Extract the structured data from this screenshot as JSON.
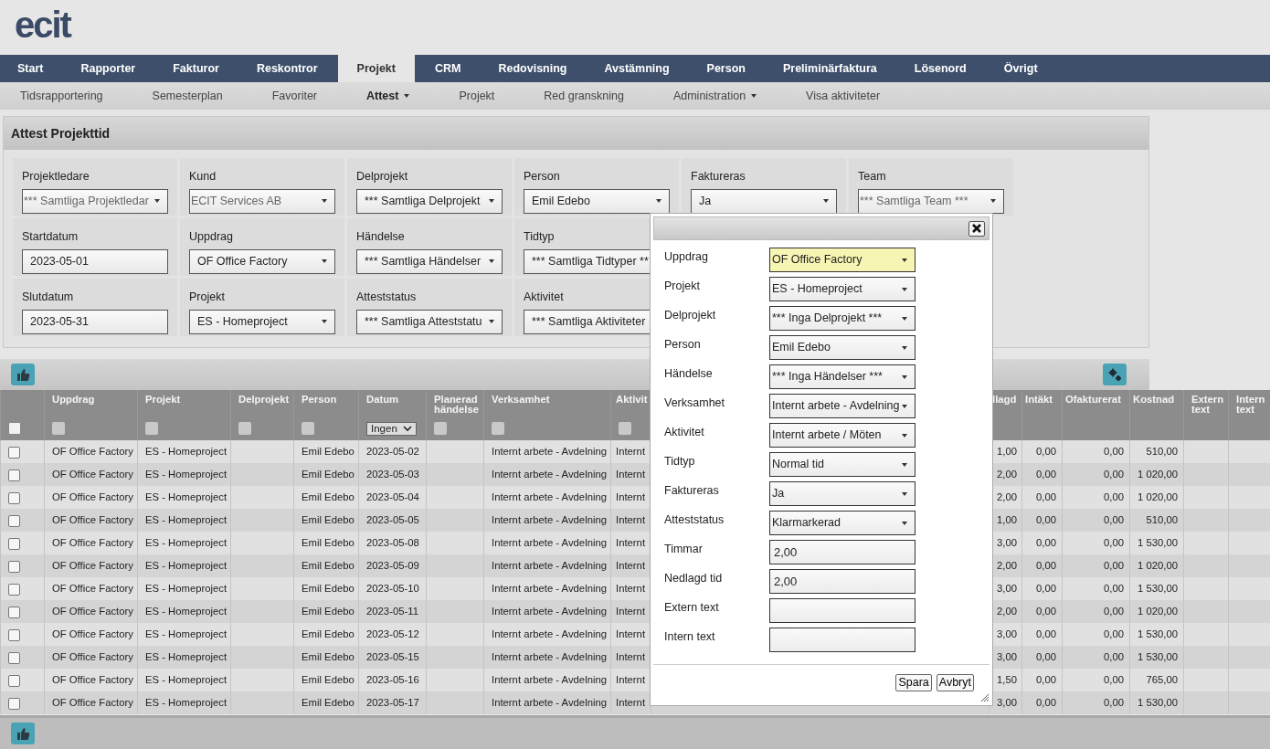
{
  "logo": "ecit",
  "main_nav": [
    {
      "label": "Start",
      "selected": false
    },
    {
      "label": "Rapporter",
      "selected": false
    },
    {
      "label": "Fakturor",
      "selected": false
    },
    {
      "label": "Reskontror",
      "selected": false
    },
    {
      "label": "Projekt",
      "selected": true
    },
    {
      "label": "CRM",
      "selected": false
    },
    {
      "label": "Redovisning",
      "selected": false
    },
    {
      "label": "Avstämning",
      "selected": false
    },
    {
      "label": "Person",
      "selected": false
    },
    {
      "label": "Preliminärfaktura",
      "selected": false
    },
    {
      "label": "Lösenord",
      "selected": false
    },
    {
      "label": "Övrigt",
      "selected": false
    }
  ],
  "sub_nav": [
    {
      "label": "Tidsrapportering",
      "selected": false,
      "dropdown": false
    },
    {
      "label": "Semesterplan",
      "selected": false,
      "dropdown": false
    },
    {
      "label": "Favoriter",
      "selected": false,
      "dropdown": false
    },
    {
      "label": "Attest",
      "selected": true,
      "dropdown": true
    },
    {
      "label": "Projekt",
      "selected": false,
      "dropdown": false
    },
    {
      "label": "Red granskning",
      "selected": false,
      "dropdown": false
    },
    {
      "label": "Administration",
      "selected": false,
      "dropdown": true
    },
    {
      "label": "Visa aktiviteter",
      "selected": false,
      "dropdown": false
    }
  ],
  "panel": {
    "title": "Attest Projekttid",
    "filter_rows": [
      [
        {
          "label": "Projektledare",
          "kind": "select",
          "value": "*** Samtliga Projektledar",
          "disabled": true
        },
        {
          "label": "Kund",
          "kind": "select",
          "value": "ECIT Services AB",
          "disabled": true
        },
        {
          "label": "Delprojekt",
          "kind": "select",
          "value": "*** Samtliga Delprojekt",
          "disabled": false
        },
        {
          "label": "Person",
          "kind": "select",
          "value": "Emil Edebo",
          "disabled": false
        },
        {
          "label": "Faktureras",
          "kind": "select",
          "value": "Ja",
          "disabled": false
        },
        {
          "label": "Team",
          "kind": "select",
          "value": "*** Samtliga Team ***",
          "disabled": true
        }
      ],
      [
        {
          "label": "Startdatum",
          "kind": "date",
          "value": "2023-05-01",
          "disabled": false
        },
        {
          "label": "Uppdrag",
          "kind": "select",
          "value": "OF Office Factory",
          "disabled": false
        },
        {
          "label": "Händelse",
          "kind": "select",
          "value": "*** Samtliga Händelser",
          "disabled": false
        },
        {
          "label": "Tidtyp",
          "kind": "select",
          "value": "*** Samtliga Tidtyper **",
          "disabled": false
        }
      ],
      [
        {
          "label": "Slutdatum",
          "kind": "date",
          "value": "2023-05-31",
          "disabled": false
        },
        {
          "label": "Projekt",
          "kind": "select",
          "value": "ES - Homeproject",
          "disabled": false
        },
        {
          "label": "Atteststatus",
          "kind": "select",
          "value": "*** Samtliga Atteststatu",
          "disabled": false
        },
        {
          "label": "Aktivitet",
          "kind": "select",
          "value": "*** Samtliga Aktiviteter",
          "disabled": false
        }
      ]
    ]
  },
  "table": {
    "select_all": {
      "checked": false
    },
    "columns": [
      {
        "label": "Uppdrag",
        "kind": "text",
        "filter_checked": false
      },
      {
        "label": "Projekt",
        "kind": "text",
        "filter_checked": false
      },
      {
        "label": "Delprojekt",
        "kind": "text",
        "filter_checked": false
      },
      {
        "label": "Person",
        "kind": "text",
        "filter_checked": false
      },
      {
        "label": "Datum",
        "kind": "text",
        "filter_value": "Ingen"
      },
      {
        "label": "Planerad händelse",
        "kind": "text",
        "filter_checked": false
      },
      {
        "label": "Verksamhet",
        "kind": "text",
        "filter_checked": false
      },
      {
        "label": "Aktivit",
        "kind": "text",
        "filter_checked": false
      },
      {
        "label": "llagd",
        "kind": "number"
      },
      {
        "label": "Intäkt",
        "kind": "number"
      },
      {
        "label": "Ofakturerat",
        "kind": "number"
      },
      {
        "label": "Kostnad",
        "kind": "number"
      },
      {
        "label": "Extern text",
        "kind": "text"
      },
      {
        "label": "Intern text",
        "kind": "text"
      }
    ],
    "rows": [
      {
        "checked": false,
        "cells": [
          "OF Office Factory",
          "ES - Homeproject",
          null,
          "Emil Edebo",
          "2023-05-02",
          null,
          "Internt arbete - Avdelning",
          "Internt",
          "1,00",
          "0,00",
          "0,00",
          "510,00",
          null,
          null
        ]
      },
      {
        "checked": false,
        "cells": [
          "OF Office Factory",
          "ES - Homeproject",
          null,
          "Emil Edebo",
          "2023-05-03",
          null,
          "Internt arbete - Avdelning",
          "Internt",
          "2,00",
          "0,00",
          "0,00",
          "1 020,00",
          null,
          null
        ]
      },
      {
        "checked": false,
        "cells": [
          "OF Office Factory",
          "ES - Homeproject",
          null,
          "Emil Edebo",
          "2023-05-04",
          null,
          "Internt arbete - Avdelning",
          "Internt",
          "2,00",
          "0,00",
          "0,00",
          "1 020,00",
          null,
          null
        ]
      },
      {
        "checked": false,
        "cells": [
          "OF Office Factory",
          "ES - Homeproject",
          null,
          "Emil Edebo",
          "2023-05-05",
          null,
          "Internt arbete - Avdelning",
          "Internt",
          "1,00",
          "0,00",
          "0,00",
          "510,00",
          null,
          null
        ]
      },
      {
        "checked": false,
        "cells": [
          "OF Office Factory",
          "ES - Homeproject",
          null,
          "Emil Edebo",
          "2023-05-08",
          null,
          "Internt arbete - Avdelning",
          "Internt",
          "3,00",
          "0,00",
          "0,00",
          "1 530,00",
          null,
          null
        ]
      },
      {
        "checked": false,
        "cells": [
          "OF Office Factory",
          "ES - Homeproject",
          null,
          "Emil Edebo",
          "2023-05-09",
          null,
          "Internt arbete - Avdelning",
          "Internt",
          "2,00",
          "0,00",
          "0,00",
          "1 020,00",
          null,
          null
        ]
      },
      {
        "checked": false,
        "cells": [
          "OF Office Factory",
          "ES - Homeproject",
          null,
          "Emil Edebo",
          "2023-05-10",
          null,
          "Internt arbete - Avdelning",
          "Internt",
          "3,00",
          "0,00",
          "0,00",
          "1 530,00",
          null,
          null
        ]
      },
      {
        "checked": false,
        "cells": [
          "OF Office Factory",
          "ES - Homeproject",
          null,
          "Emil Edebo",
          "2023-05-11",
          null,
          "Internt arbete - Avdelning",
          "Internt",
          "2,00",
          "0,00",
          "0,00",
          "1 020,00",
          null,
          null
        ]
      },
      {
        "checked": false,
        "cells": [
          "OF Office Factory",
          "ES - Homeproject",
          null,
          "Emil Edebo",
          "2023-05-12",
          null,
          "Internt arbete - Avdelning",
          "Internt",
          "3,00",
          "0,00",
          "0,00",
          "1 530,00",
          null,
          null
        ]
      },
      {
        "checked": false,
        "cells": [
          "OF Office Factory",
          "ES - Homeproject",
          null,
          "Emil Edebo",
          "2023-05-15",
          null,
          "Internt arbete - Avdelning",
          "Internt",
          "3,00",
          "0,00",
          "0,00",
          "1 530,00",
          null,
          null
        ]
      },
      {
        "checked": false,
        "cells": [
          "OF Office Factory",
          "ES - Homeproject",
          null,
          "Emil Edebo",
          "2023-05-16",
          null,
          "Internt arbete - Avdelning",
          "Internt",
          "1,50",
          "0,00",
          "0,00",
          "765,00",
          null,
          null
        ]
      },
      {
        "checked": false,
        "cells": [
          "OF Office Factory",
          "ES - Homeproject",
          null,
          "Emil Edebo",
          "2023-05-17",
          null,
          "Internt arbete - Avdelning",
          "Internt",
          "3,00",
          "0,00",
          "0,00",
          "1 530,00",
          null,
          null
        ]
      }
    ]
  },
  "dialog": {
    "fields": [
      {
        "label": "Uppdrag",
        "kind": "select",
        "value": "OF Office Factory",
        "focused": true
      },
      {
        "label": "Projekt",
        "kind": "select",
        "value": "ES - Homeproject",
        "focused": false
      },
      {
        "label": "Delprojekt",
        "kind": "select",
        "value": "*** Inga Delprojekt ***",
        "focused": false
      },
      {
        "label": "Person",
        "kind": "select",
        "value": "Emil Edebo",
        "focused": false
      },
      {
        "label": "Händelse",
        "kind": "select",
        "value": "*** Inga Händelser ***",
        "focused": false
      },
      {
        "label": "Verksamhet",
        "kind": "select",
        "value": "Internt arbete - Avdelning",
        "focused": false
      },
      {
        "label": "Aktivitet",
        "kind": "select",
        "value": "Internt arbete / Möten",
        "focused": false
      },
      {
        "label": "Tidtyp",
        "kind": "select",
        "value": "Normal tid",
        "focused": false
      },
      {
        "label": "Faktureras",
        "kind": "select",
        "value": "Ja",
        "focused": false
      },
      {
        "label": "Atteststatus",
        "kind": "select",
        "value": "Klarmarkerad",
        "focused": false
      },
      {
        "label": "Timmar",
        "kind": "input",
        "value": "2,00",
        "focused": false
      },
      {
        "label": "Nedlagd tid",
        "kind": "input",
        "value": "2,00",
        "focused": false
      },
      {
        "label": "Extern text",
        "kind": "input",
        "focused": false
      },
      {
        "label": "Intern text",
        "kind": "input",
        "focused": false
      }
    ],
    "buttons": [
      "Spara",
      "Avbryt"
    ]
  }
}
